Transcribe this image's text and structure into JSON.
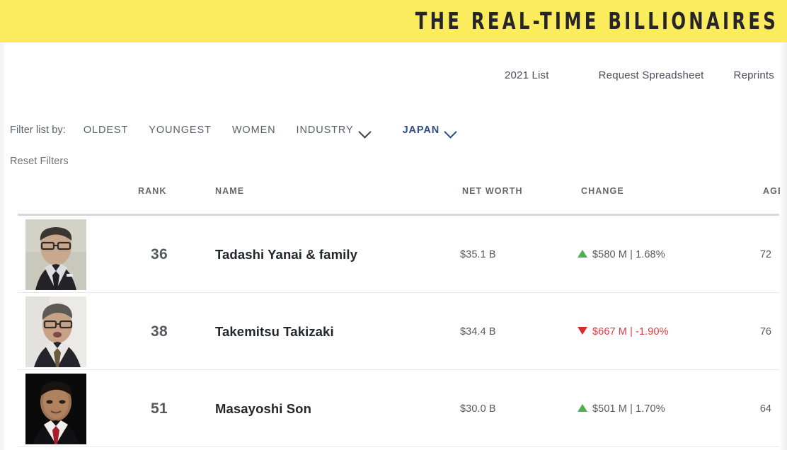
{
  "banner": {
    "title": "THE REAL-TIME BILLIONAIRES",
    "background_color": "#fbec5d",
    "text_color": "#26262a"
  },
  "topnav": {
    "items": [
      {
        "label": "2021 List"
      },
      {
        "label": "Request Spreadsheet"
      },
      {
        "label": "Reprints"
      }
    ]
  },
  "filters": {
    "label": "Filter list by:",
    "items": [
      {
        "label": "OLDEST",
        "caret": false,
        "active": false
      },
      {
        "label": "YOUNGEST",
        "caret": false,
        "active": false
      },
      {
        "label": "WOMEN",
        "caret": false,
        "active": false
      },
      {
        "label": "INDUSTRY",
        "caret": true,
        "active": false
      },
      {
        "label": "JAPAN",
        "caret": true,
        "active": true
      }
    ],
    "active_color": "#2e4d88",
    "reset_label": "Reset Filters"
  },
  "table": {
    "columns": [
      "RANK",
      "NAME",
      "NET WORTH",
      "CHANGE",
      "AGE"
    ],
    "rows": [
      {
        "rank": "36",
        "name": "Tadashi Yanai & family",
        "net_worth": "$35.1 B",
        "change": "$580 M | 1.68%",
        "change_direction": "up",
        "age": "72",
        "photo": "portrait-tadashi-yanai"
      },
      {
        "rank": "38",
        "name": "Takemitsu Takizaki",
        "net_worth": "$34.4 B",
        "change": "$667 M | -1.90%",
        "change_direction": "down",
        "age": "76",
        "photo": "portrait-takemitsu-takizaki"
      },
      {
        "rank": "51",
        "name": "Masayoshi Son",
        "net_worth": "$30.0 B",
        "change": "$501 M | 1.70%",
        "change_direction": "up",
        "age": "64",
        "photo": "portrait-masayoshi-son"
      }
    ],
    "colors": {
      "change_up": "#4caf50",
      "change_down": "#d92b2b",
      "header_rule": "#d6d8da",
      "row_rule": "#e7e8ea"
    }
  }
}
